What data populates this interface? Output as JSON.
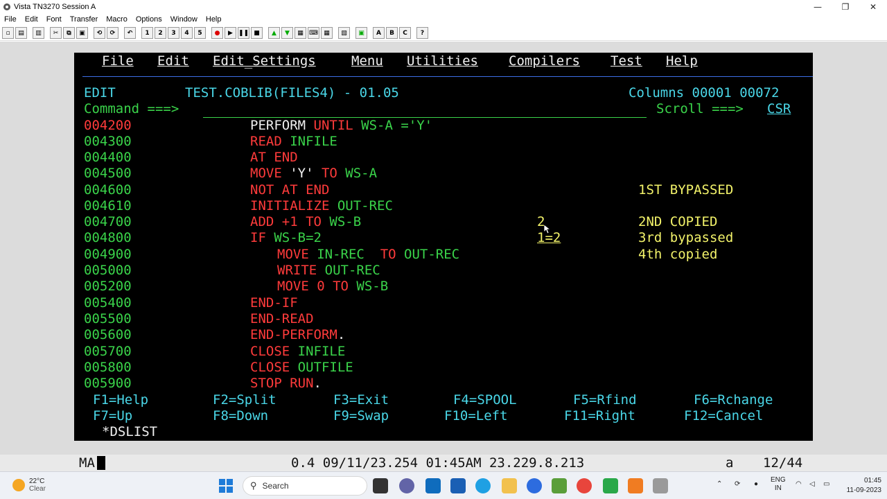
{
  "window": {
    "title": "Vista TN3270 Session A",
    "controls": [
      "—",
      "❐",
      "✕"
    ]
  },
  "menubar": [
    "File",
    "Edit",
    "Font",
    "Transfer",
    "Macro",
    "Options",
    "Window",
    "Help"
  ],
  "toolbar": {
    "macro_labels": [
      "1",
      "2",
      "3",
      "4",
      "5"
    ],
    "hotspot_labels": [
      "A",
      "B",
      "C",
      "?"
    ]
  },
  "ispf": {
    "menu": [
      "File",
      "Edit",
      "Edit_Settings",
      "Menu",
      "Utilities",
      "Compilers",
      "Test",
      "Help"
    ],
    "mode": "EDIT",
    "dataset": "TEST.COBLIB(FILES4) - 01.05",
    "columns_label": "Columns",
    "col_start": "00001",
    "col_end": "00072",
    "command_label": "Command ===>",
    "command_value": "",
    "scroll_label": "Scroll ===>",
    "scroll_value": "CSR",
    "lines": [
      {
        "num": "004200",
        "segs": [
          "PERFORM ",
          "UNTIL ",
          "WS-A ='Y'"
        ]
      },
      {
        "num": "004300",
        "segs": [
          "READ ",
          "INFILE"
        ]
      },
      {
        "num": "004400",
        "segs": [
          "AT END"
        ]
      },
      {
        "num": "004500",
        "segs": [
          "MOVE ",
          "'Y' ",
          "TO ",
          "WS-A"
        ]
      },
      {
        "num": "004600",
        "segs": [
          "NOT AT END"
        ]
      },
      {
        "num": "004610",
        "segs": [
          "INITIALIZE ",
          "OUT-REC"
        ]
      },
      {
        "num": "004700",
        "segs": [
          "ADD +1 TO ",
          "WS-B"
        ]
      },
      {
        "num": "004800",
        "segs": [
          "IF ",
          "WS-B=2"
        ]
      },
      {
        "num": "004900",
        "segs": [
          "MOVE ",
          "IN-REC  ",
          "TO ",
          "OUT-REC"
        ]
      },
      {
        "num": "005000",
        "segs": [
          "WRITE ",
          "OUT-REC"
        ]
      },
      {
        "num": "005200",
        "segs": [
          "MOVE 0 TO ",
          "WS-B"
        ]
      },
      {
        "num": "005400",
        "segs": [
          "END-IF"
        ]
      },
      {
        "num": "005500",
        "segs": [
          "END-READ"
        ]
      },
      {
        "num": "005600",
        "segs": [
          "END-PERFORM",
          "."
        ]
      },
      {
        "num": "005700",
        "segs": [
          "CLOSE ",
          "INFILE"
        ]
      },
      {
        "num": "005800",
        "segs": [
          "CLOSE ",
          "OUTFILE"
        ]
      },
      {
        "num": "005900",
        "segs": [
          "STOP RUN",
          "."
        ]
      }
    ],
    "notes": {
      "n2": "2",
      "n1eq2": "1=2",
      "first": "1ST BYPASSED",
      "second": "2ND COPIED",
      "third": "3rd bypassed",
      "fourth": "4th copied"
    },
    "fkeys_row1": [
      "F1=Help",
      "F2=Split",
      "F3=Exit",
      "F4=SPOOL",
      "F5=Rfind",
      "F6=Rchange"
    ],
    "fkeys_row2": [
      "F7=Up",
      "F8=Down",
      "F9=Swap",
      "F10=Left",
      "F11=Right",
      "F12=Cancel"
    ],
    "dslist": "*DSLIST"
  },
  "status": {
    "left": "MA",
    "center": "0.4 09/11/23.254 01:45AM 23.229.8.213",
    "mode": "a",
    "pos": "12/44"
  },
  "taskbar": {
    "temp": "22°C",
    "weather": "Clear",
    "search_placeholder": "Search",
    "lang1": "ENG",
    "lang2": "IN",
    "time": "01:45",
    "date": "11-09-2023"
  },
  "colors": {
    "terminal_bg": "#000000",
    "cyan": "#4ad7e8",
    "green": "#3ad34a",
    "red": "#ff3b3b",
    "yellow": "#f3f36a"
  }
}
